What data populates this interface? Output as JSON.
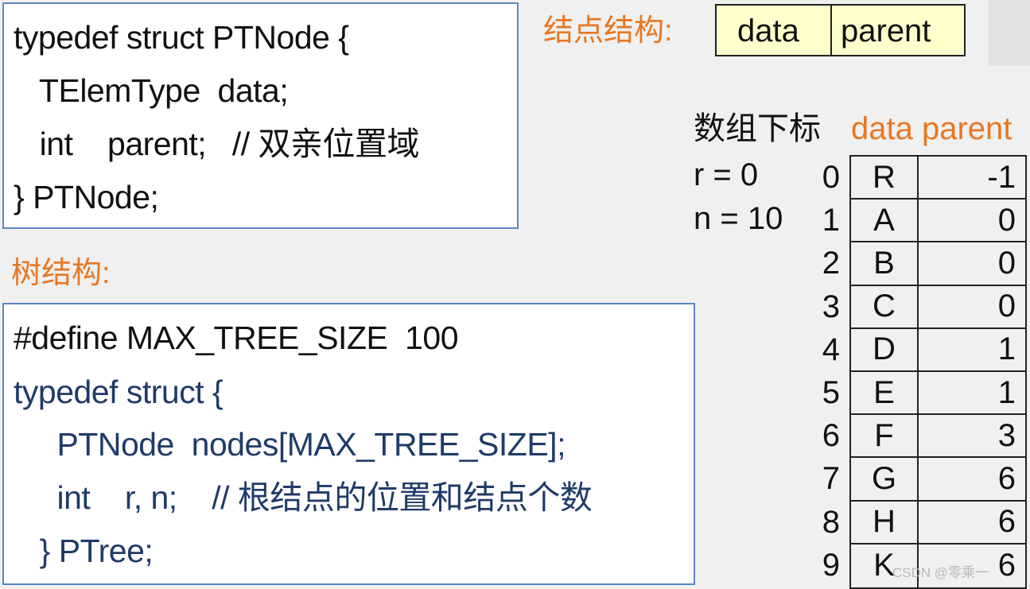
{
  "node_struct_code": {
    "lines": [
      "typedef struct PTNode {",
      "   TElemType  data;",
      "   int    parent;   // 双亲位置域",
      "} PTNode;"
    ]
  },
  "node_struct_label": "结点结构:",
  "node_struct_fields": [
    "data",
    "parent"
  ],
  "tree_struct_label": "树结构:",
  "tree_struct_code": {
    "lines": [
      "#define MAX_TREE_SIZE  100",
      "typedef struct {",
      "     PTNode  nodes[MAX_TREE_SIZE];",
      "     int    r, n;    // 根结点的位置和结点个数",
      "   } PTree;"
    ]
  },
  "array_header": {
    "index_label": "数组下标",
    "columns_label": "data parent"
  },
  "tree_info": {
    "r": "r = 0",
    "n": "n = 10"
  },
  "table": {
    "rows": [
      {
        "index": "0",
        "data": "R",
        "parent": "-1"
      },
      {
        "index": "1",
        "data": "A",
        "parent": "0"
      },
      {
        "index": "2",
        "data": "B",
        "parent": "0"
      },
      {
        "index": "3",
        "data": "C",
        "parent": "0"
      },
      {
        "index": "4",
        "data": "D",
        "parent": "1"
      },
      {
        "index": "5",
        "data": "E",
        "parent": "1"
      },
      {
        "index": "6",
        "data": "F",
        "parent": "3"
      },
      {
        "index": "7",
        "data": "G",
        "parent": "6"
      },
      {
        "index": "8",
        "data": "H",
        "parent": "6"
      },
      {
        "index": "9",
        "data": "K",
        "parent": "6"
      }
    ]
  },
  "watermark": "CSDN @零乘一",
  "colors": {
    "accent_orange": "#e87722",
    "code_navy": "#1f3b68",
    "box_border": "#5b87c2",
    "cell_fill": "#ffffcc"
  }
}
